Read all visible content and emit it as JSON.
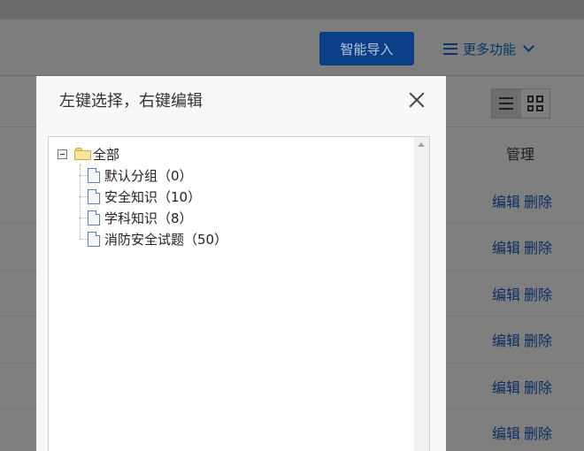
{
  "toolbar": {
    "smart_import_label": "智能导入",
    "more_functions_label": "更多功能"
  },
  "view_toggle": {
    "active": "list"
  },
  "table": {
    "manage_header": "管理",
    "rows": [
      {
        "edit": "编辑",
        "delete": "删除"
      },
      {
        "edit": "编辑",
        "delete": "删除"
      },
      {
        "edit": "编辑",
        "delete": "删除"
      },
      {
        "edit": "编辑",
        "delete": "删除"
      },
      {
        "edit": "编辑",
        "delete": "删除"
      },
      {
        "edit": "编辑",
        "delete": "删除"
      }
    ]
  },
  "modal": {
    "title": "左键选择，右键编辑",
    "tree": {
      "root_label": "全部",
      "children": [
        {
          "label": "默认分组（0）"
        },
        {
          "label": "安全知识（10）"
        },
        {
          "label": "学科知识（8）"
        },
        {
          "label": "消防安全试题（50）"
        }
      ]
    }
  },
  "colors": {
    "primary_button": "#0a3f86",
    "link": "#0d2d63",
    "overlay_bg": "#7f7f7f"
  }
}
